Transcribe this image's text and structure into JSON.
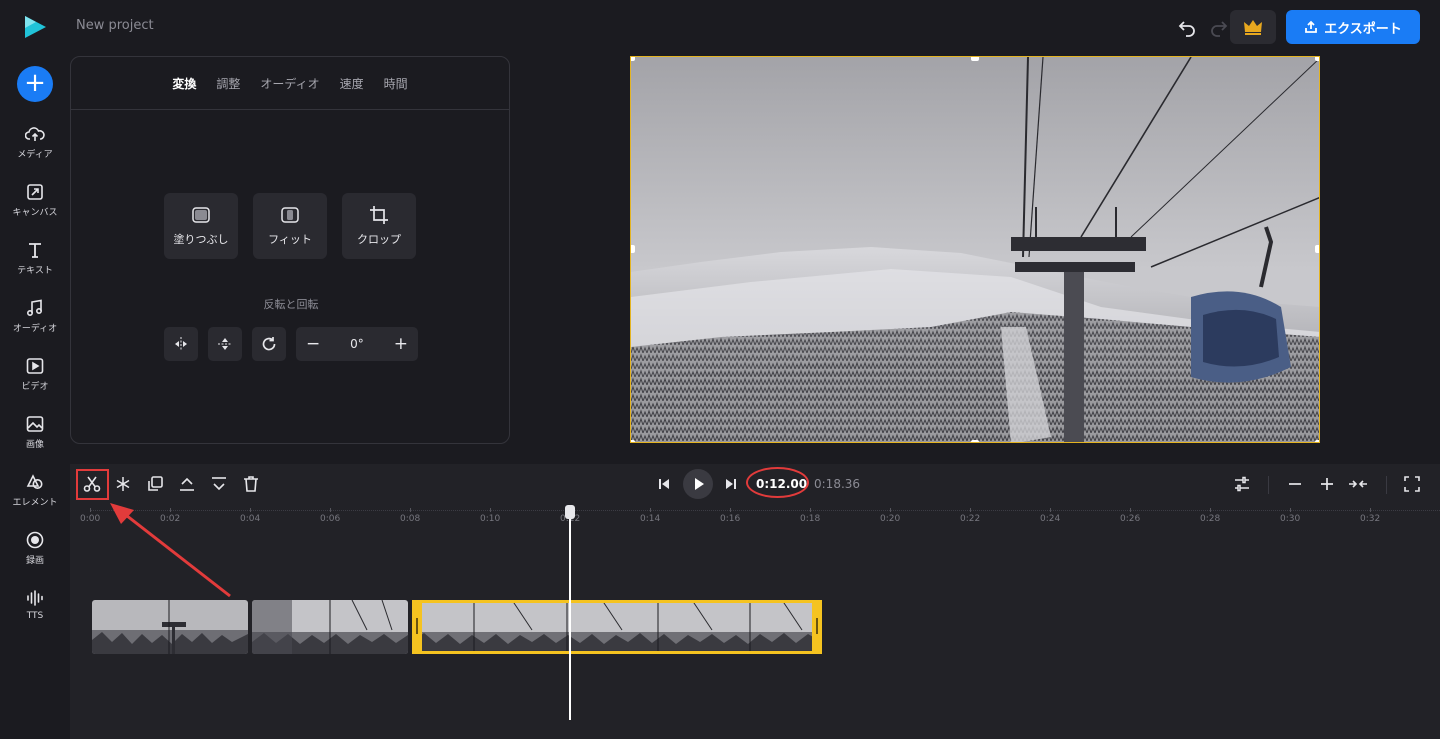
{
  "app": {
    "project_name": "New project",
    "export_label": "エクスポート"
  },
  "rail": {
    "items": [
      {
        "label": "メディア",
        "icon": "upload-cloud-icon"
      },
      {
        "label": "キャンバス",
        "icon": "canvas-icon"
      },
      {
        "label": "テキスト",
        "icon": "text-icon"
      },
      {
        "label": "オーディオ",
        "icon": "music-icon"
      },
      {
        "label": "ビデオ",
        "icon": "video-icon"
      },
      {
        "label": "画像",
        "icon": "image-icon"
      },
      {
        "label": "エレメント",
        "icon": "elements-icon"
      },
      {
        "label": "録画",
        "icon": "record-icon"
      },
      {
        "label": "TTS",
        "icon": "tts-icon"
      }
    ]
  },
  "panel": {
    "tabs": [
      "変換",
      "調整",
      "オーディオ",
      "速度",
      "時間"
    ],
    "active_tab": "変換",
    "fit_buttons": [
      "塗りつぶし",
      "フィット",
      "クロップ"
    ],
    "flip_title": "反転と回転",
    "rotation_value": "0°"
  },
  "playback": {
    "current_time": "0:12.00",
    "total_time": "0:18.36"
  },
  "timeline": {
    "ruler": [
      "0:00",
      "0:02",
      "0:04",
      "0:06",
      "0:08",
      "0:10",
      "0:12",
      "0:14",
      "0:16",
      "0:18",
      "0:20",
      "0:22",
      "0:24",
      "0:26",
      "0:28",
      "0:30",
      "0:32"
    ]
  },
  "colors": {
    "accent": "#1a7cf5",
    "selection": "#f5c320",
    "annotation": "#e23b3b",
    "background": "#1b1b20"
  }
}
